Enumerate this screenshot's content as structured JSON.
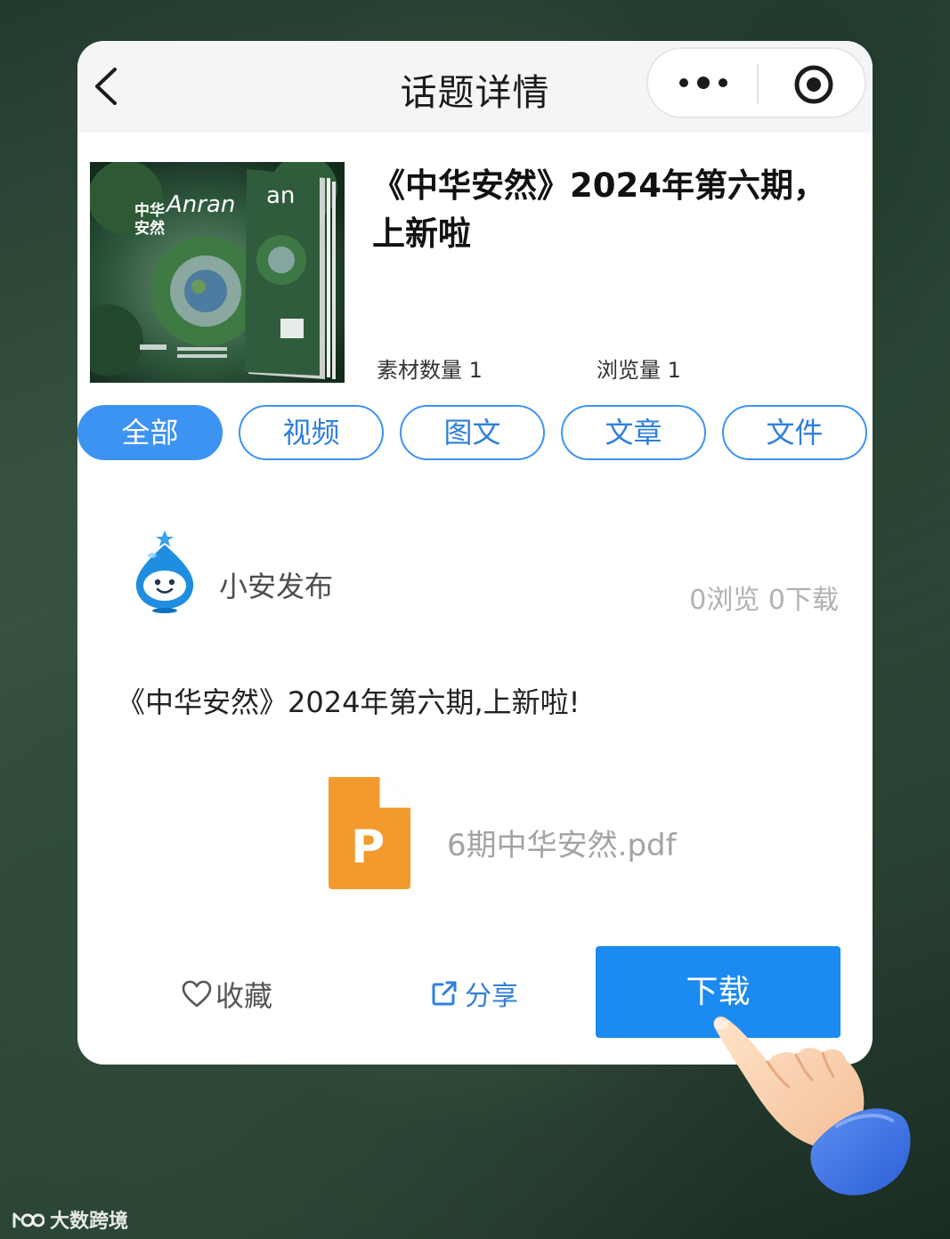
{
  "navbar": {
    "title": "话题详情",
    "back_icon": "chevron-left-icon",
    "more_icon": "more-dots-icon",
    "close_icon": "target-circle-icon"
  },
  "topic": {
    "title": "《中华安然》2024年第六期，上新啦",
    "cover_text": "中华安然 Anran",
    "material_count": "素材数量 1",
    "view_count": "浏览量 1"
  },
  "tabs": [
    {
      "label": "全部",
      "active": true
    },
    {
      "label": "视频",
      "active": false
    },
    {
      "label": "图文",
      "active": false
    },
    {
      "label": "文章",
      "active": false
    },
    {
      "label": "文件",
      "active": false
    }
  ],
  "post": {
    "publisher": "小安发布",
    "counts": "0浏览  0下载",
    "text": "《中华安然》2024年第六期,上新啦!",
    "file": {
      "name": "6期中华安然.pdf",
      "icon": "pdf-file-icon",
      "icon_letter": "P"
    }
  },
  "actions": {
    "favorite_label": "收藏",
    "share_label": "分享",
    "download_label": "下载"
  },
  "watermark": "大数跨境",
  "colors": {
    "accent": "#3d93f2",
    "download_button": "#1b8af1",
    "file_icon": "#f29a2e"
  }
}
